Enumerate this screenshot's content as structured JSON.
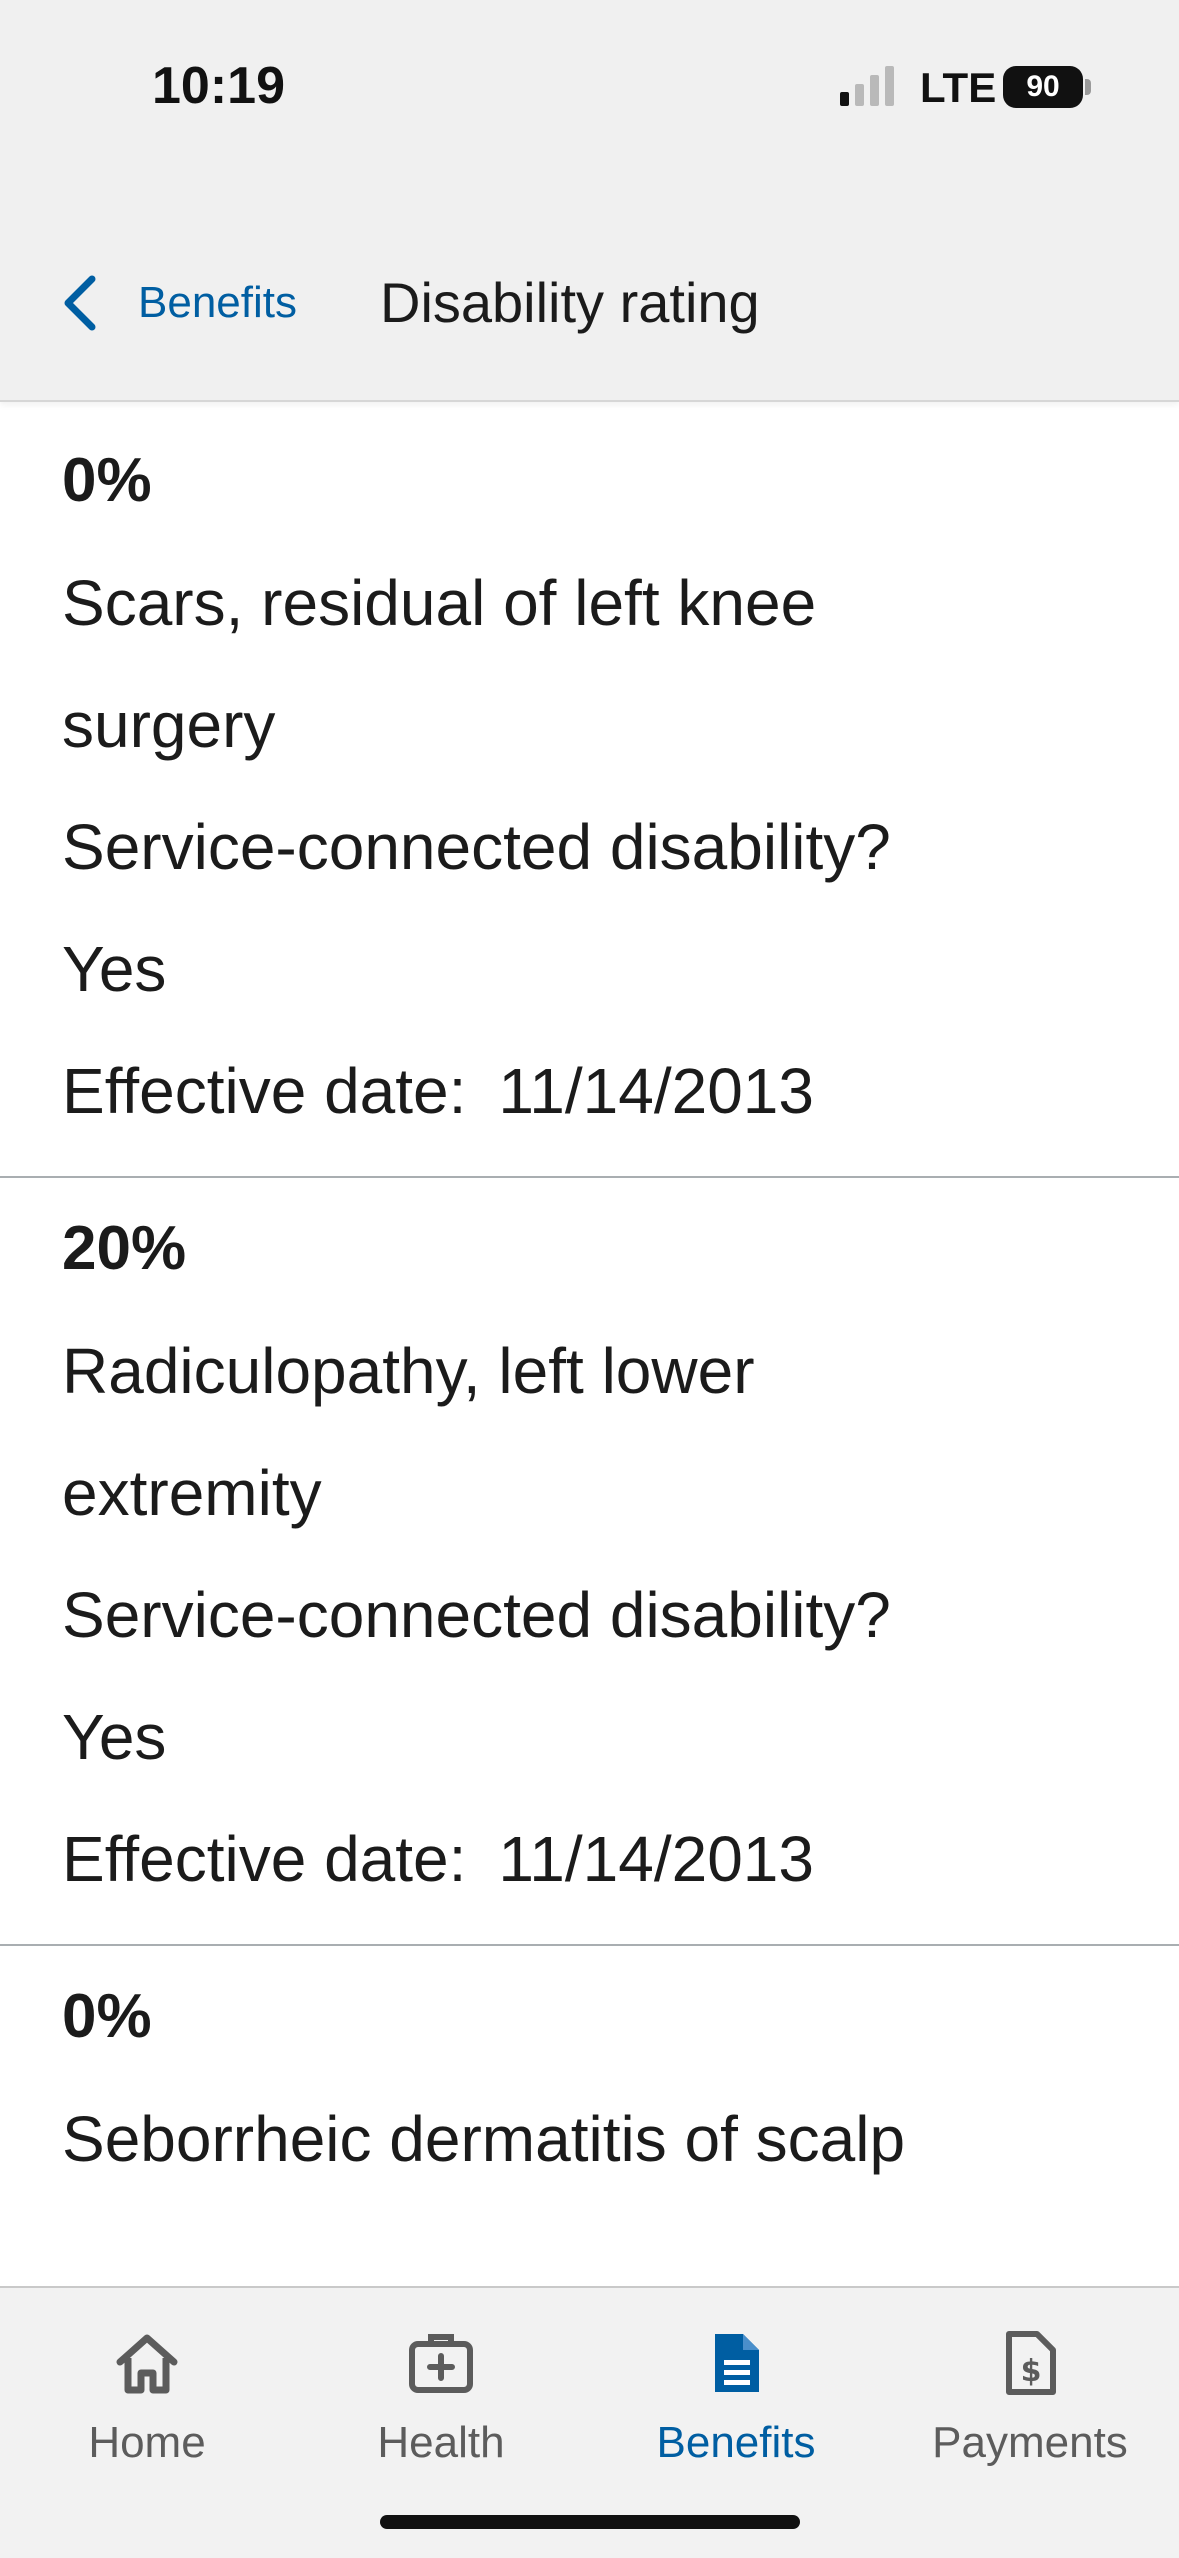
{
  "status_bar": {
    "time": "10:19",
    "network": "LTE",
    "battery": "90"
  },
  "header": {
    "back_label": "Benefits",
    "title": "Disability rating"
  },
  "ratings": [
    {
      "percent": "0%",
      "condition_line1": "Scars, residual of left knee",
      "condition_line2": "surgery",
      "service_connected_label": "Service-connected disability?",
      "service_connected_value": "Yes",
      "effective_label": "Effective date:",
      "effective_value": "11/14/2013"
    },
    {
      "percent": "20%",
      "condition_line1": "Radiculopathy, left lower",
      "condition_line2": "extremity",
      "service_connected_label": "Service-connected disability?",
      "service_connected_value": "Yes",
      "effective_label": "Effective date:",
      "effective_value": "11/14/2013"
    },
    {
      "percent": "0%",
      "condition_line1": "Seborrheic dermatitis of scalp"
    }
  ],
  "tabs": [
    {
      "label": "Home",
      "icon": "home-icon"
    },
    {
      "label": "Health",
      "icon": "medical-kit-icon"
    },
    {
      "label": "Benefits",
      "icon": "document-icon",
      "active": true
    },
    {
      "label": "Payments",
      "icon": "dollar-document-icon"
    }
  ],
  "colors": {
    "accent": "#005ea2",
    "header_bg": "#f0f0f0",
    "tab_inactive": "#5c5c5c",
    "divider": "#a9aeb1"
  }
}
